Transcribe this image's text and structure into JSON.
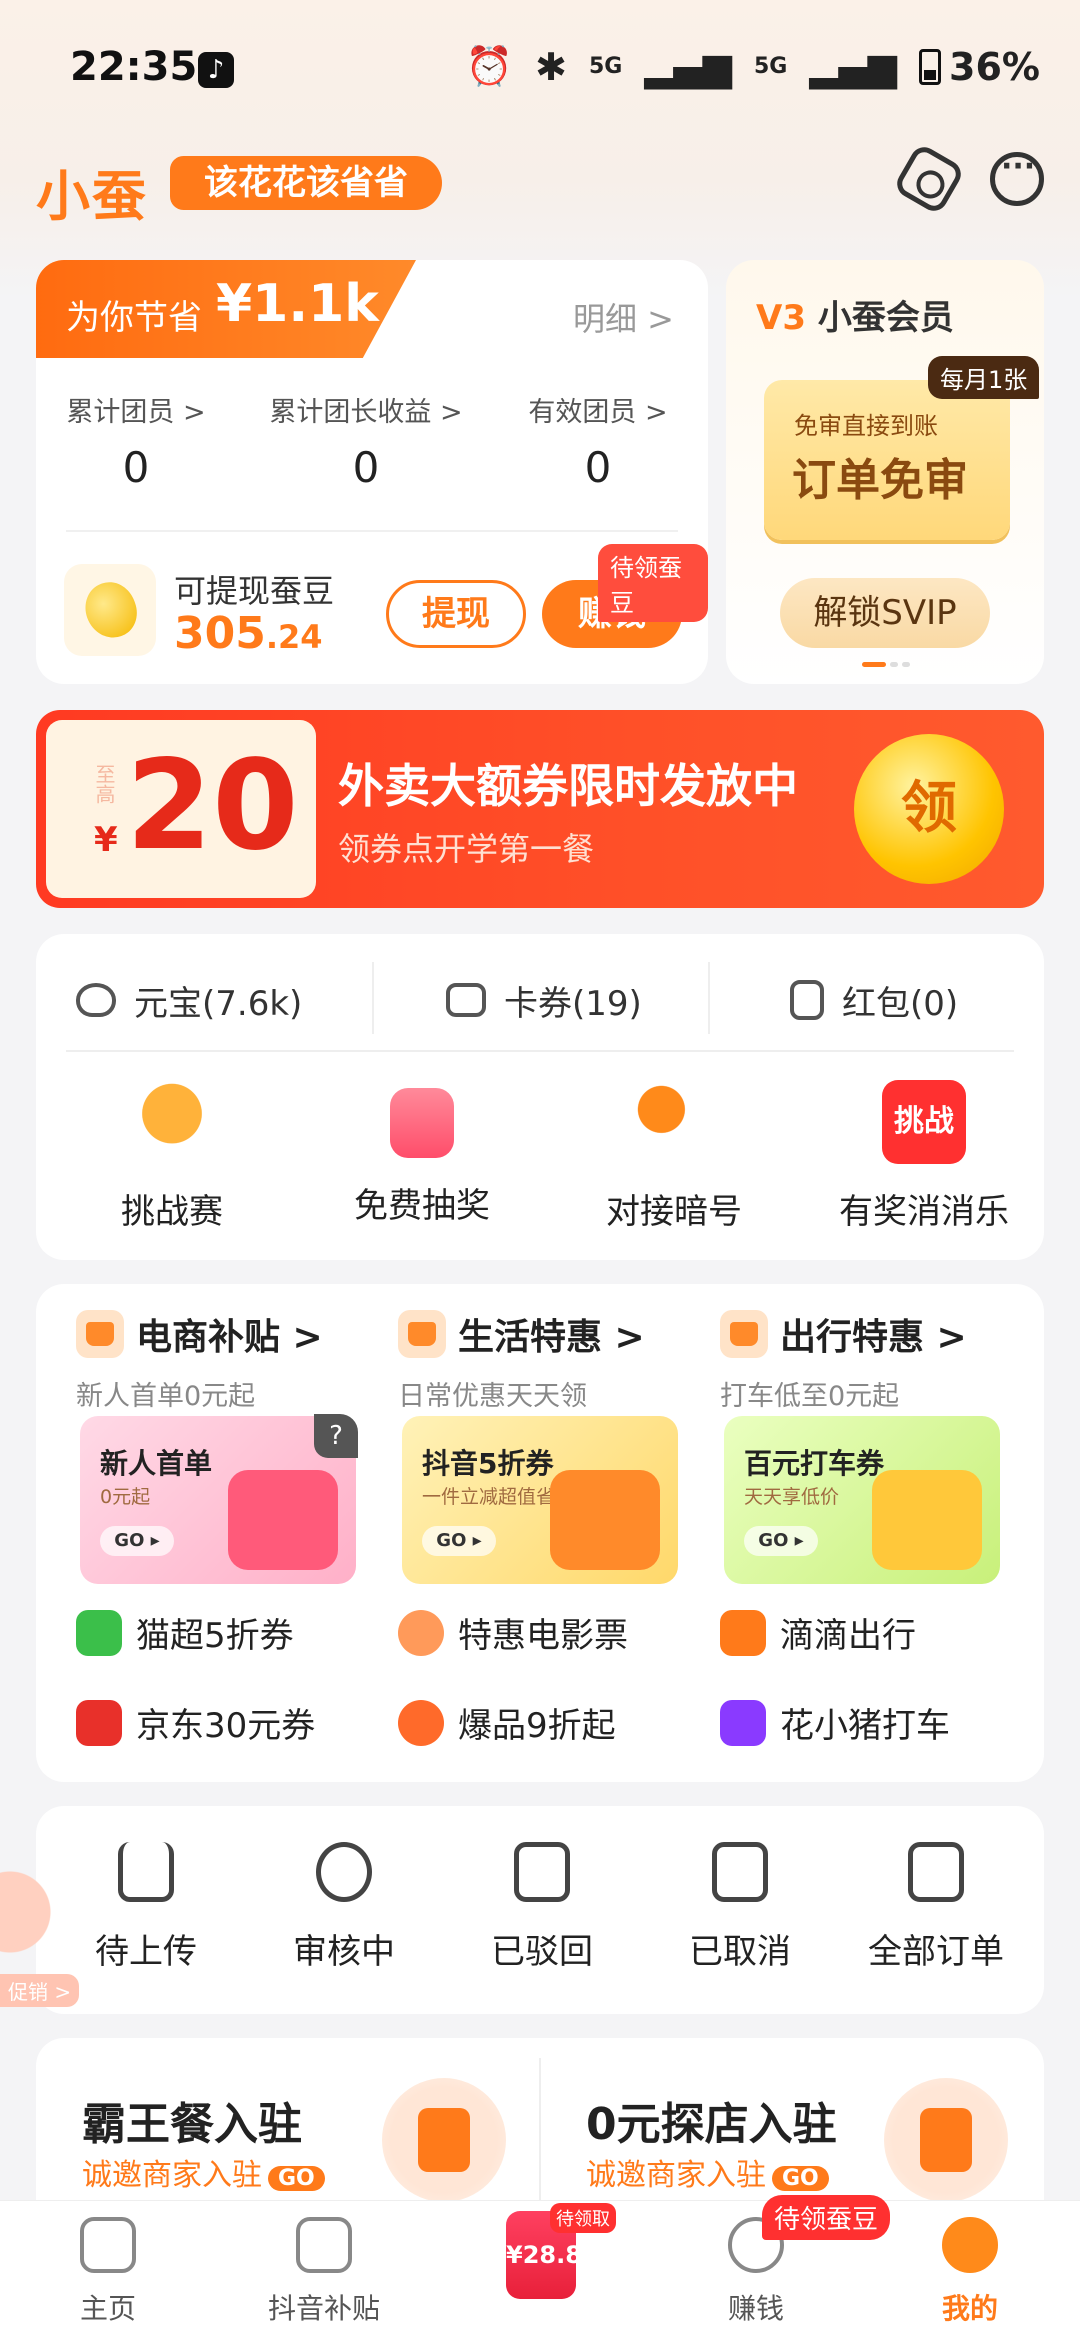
{
  "status_bar": {
    "time": "22:35",
    "network1": "5G",
    "network2": "5G",
    "battery": "36%"
  },
  "header": {
    "logo": "小蚕",
    "slogan": "该花花该省省"
  },
  "savings": {
    "label": "为你节省",
    "amount": "¥1.1k",
    "detail": "明细 >",
    "stats": [
      {
        "title": "累计团员 >",
        "value": "0"
      },
      {
        "title": "累计团长收益 >",
        "value": "0"
      },
      {
        "title": "有效团员 >",
        "value": "0"
      }
    ],
    "bean_label": "可提现蚕豆",
    "bean_int": "305",
    "bean_dec": ".24",
    "withdraw": "提现",
    "earn": "赚钱",
    "pending_badge": "待领蚕豆"
  },
  "vip": {
    "level": "V3",
    "title": "小蚕会员",
    "monthly": "每月1张",
    "coupon_line1": "免审直接到账",
    "coupon_line2": "订单免审",
    "unlock": "解锁SVIP"
  },
  "banner": {
    "min_label": "至高",
    "currency": "¥",
    "amount": "20",
    "title": "外卖大额券限时发放中",
    "subtitle": "领券点开学第一餐",
    "claim": "领"
  },
  "wallet": [
    {
      "label": "元宝(7.6k)",
      "icon": "ingot-icon"
    },
    {
      "label": "卡券(19)",
      "icon": "ticket-icon"
    },
    {
      "label": "红包(0)",
      "icon": "red-packet-icon"
    }
  ],
  "activities": [
    {
      "label": "挑战赛",
      "icon": "trophy-icon"
    },
    {
      "label": "免费抽奖",
      "icon": "gift-icon"
    },
    {
      "label": "对接暗号",
      "icon": "key-icon"
    },
    {
      "label": "有奖消消乐",
      "icon": "challenge-icon",
      "icon_text": "挑战"
    }
  ],
  "benefits": [
    {
      "title": "电商补贴 >",
      "subtitle": "新人首单0元起",
      "tile_title": "新人首单",
      "tile_sub": "0元起",
      "go": "GO ▸"
    },
    {
      "title": "生活特惠 >",
      "subtitle": "日常优惠天天领",
      "tile_title": "抖音5折券",
      "tile_sub": "一件立减超值省",
      "go": "GO ▸"
    },
    {
      "title": "出行特惠 >",
      "subtitle": "打车低至0元起",
      "tile_title": "百元打车券",
      "tile_sub": "天天享低价",
      "go": "GO ▸"
    }
  ],
  "benefit_links": [
    {
      "label": "猫超5折券",
      "color": "#3bbf4a"
    },
    {
      "label": "特惠电影票",
      "color": "#ff9a5a"
    },
    {
      "label": "滴滴出行",
      "color": "#ff7a1a"
    },
    {
      "label": "京东30元券",
      "color": "#e8302a"
    },
    {
      "label": "爆品9折起",
      "color": "#ff6a2a"
    },
    {
      "label": "花小猪打车",
      "color": "#8a3aff"
    }
  ],
  "help_icon": "?",
  "orders": [
    {
      "label": "待上传",
      "icon": "upload-icon",
      "glyph": "↑"
    },
    {
      "label": "审核中",
      "icon": "clock-icon",
      "glyph": "◷"
    },
    {
      "label": "已驳回",
      "icon": "rejected-icon",
      "glyph": "↺"
    },
    {
      "label": "已取消",
      "icon": "cancelled-icon",
      "glyph": "✕"
    },
    {
      "label": "全部订单",
      "icon": "clipboard-icon",
      "glyph": "≡"
    }
  ],
  "side_float": "促销 >",
  "merchants": [
    {
      "title": "霸王餐入驻",
      "subtitle": "诚邀商家入驻",
      "go": "GO"
    },
    {
      "title": "0元探店入驻",
      "subtitle": "诚邀商家入驻",
      "go": "GO"
    }
  ],
  "nav": {
    "items": [
      {
        "label": "主页"
      },
      {
        "label": "抖音补贴"
      },
      {
        "label": "赚钱"
      },
      {
        "label": "我的"
      }
    ],
    "center_price": "¥28.8",
    "center_badge": "待领取",
    "earn_badge": "待领蚕豆"
  }
}
